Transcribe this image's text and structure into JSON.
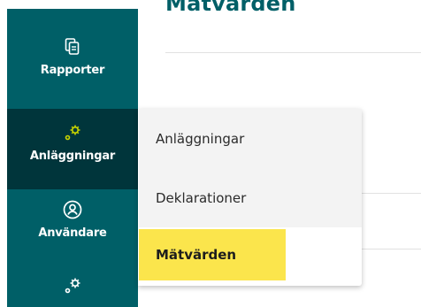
{
  "page": {
    "title": "Mätvärden"
  },
  "sidebar": {
    "items": [
      {
        "label": "Rapporter",
        "icon": "document-copy-icon"
      },
      {
        "label": "Anläggningar",
        "icon": "gears-icon",
        "active": true
      },
      {
        "label": "Användare",
        "icon": "user-circle-icon"
      },
      {
        "label": "",
        "icon": "gears-icon"
      }
    ]
  },
  "flyout": {
    "items": [
      {
        "label": "Anläggningar"
      },
      {
        "label": "Deklarationer"
      },
      {
        "label": "Mätvärden",
        "highlighted": true
      }
    ]
  },
  "colors": {
    "sidebar": "#005f67",
    "sidebar_active": "#00353b",
    "icon_accent": "#c8d400",
    "highlight": "#fbe54c",
    "title": "#005f67"
  }
}
